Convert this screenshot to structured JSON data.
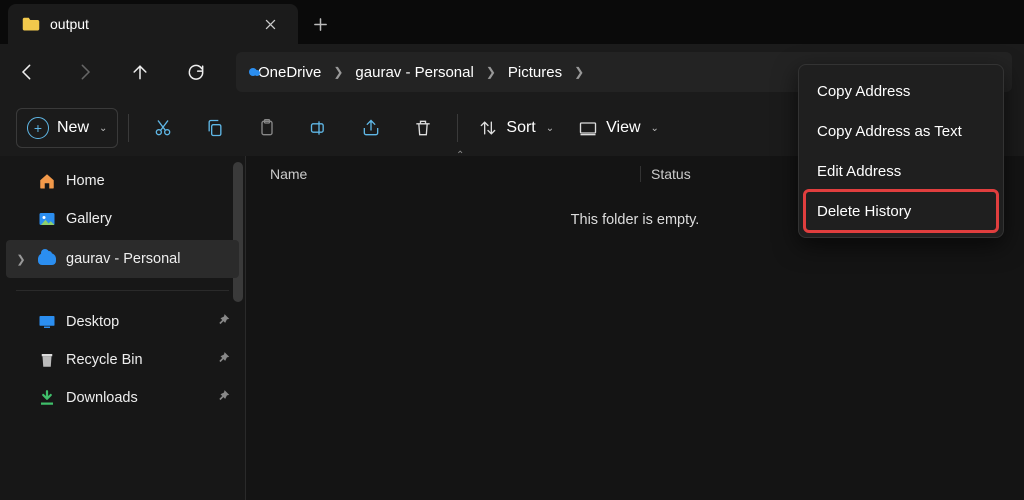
{
  "tab": {
    "title": "output"
  },
  "breadcrumb": {
    "items": [
      {
        "label": "OneDrive"
      },
      {
        "label": "gaurav - Personal"
      },
      {
        "label": "Pictures"
      }
    ]
  },
  "toolbar": {
    "new_label": "New",
    "sort_label": "Sort",
    "view_label": "View"
  },
  "sidebar": {
    "top": [
      {
        "label": "Home"
      },
      {
        "label": "Gallery"
      },
      {
        "label": "gaurav - Personal"
      }
    ],
    "pinned": [
      {
        "label": "Desktop"
      },
      {
        "label": "Recycle Bin"
      },
      {
        "label": "Downloads"
      }
    ]
  },
  "columns": {
    "name": "Name",
    "status": "Status"
  },
  "empty_text": "This folder is empty.",
  "context_menu": {
    "items": [
      {
        "label": "Copy Address"
      },
      {
        "label": "Copy Address as Text"
      },
      {
        "label": "Edit Address"
      },
      {
        "label": "Delete History"
      }
    ]
  }
}
